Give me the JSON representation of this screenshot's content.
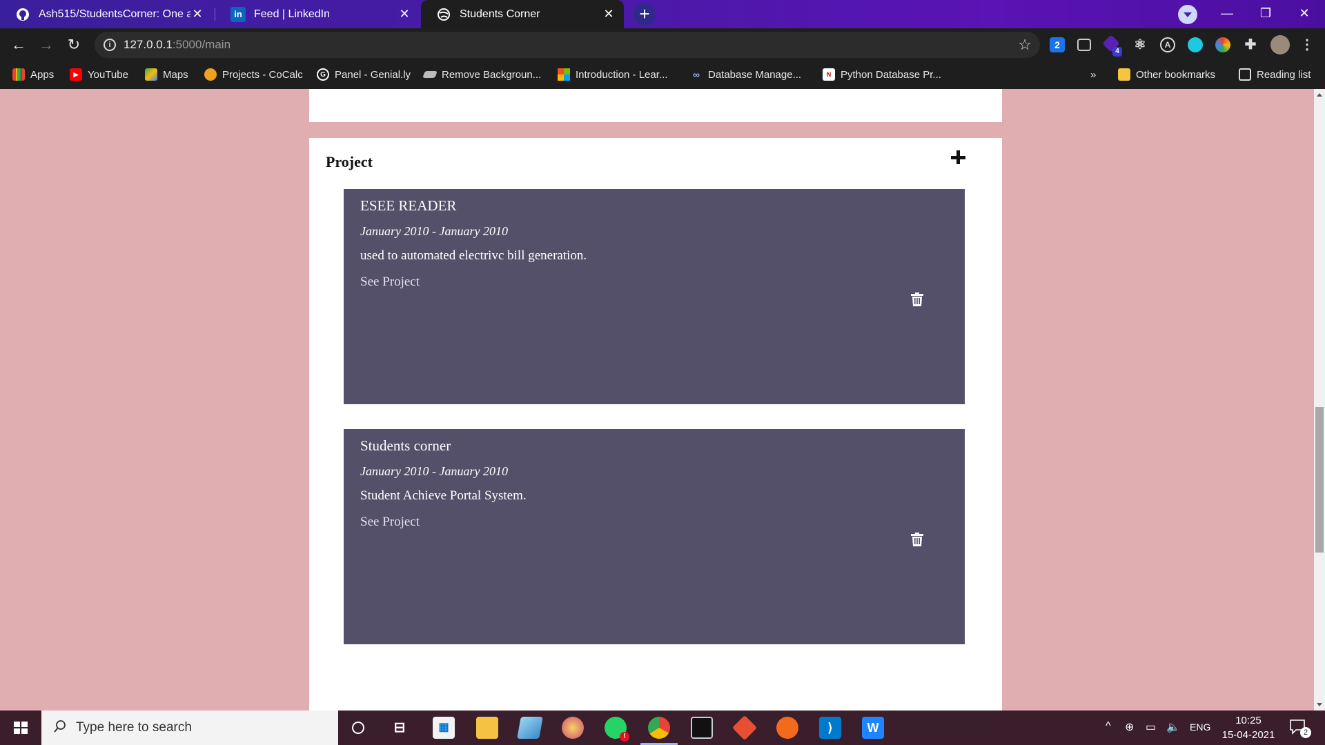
{
  "browser": {
    "tabs": [
      {
        "title": "Ash515/StudentsCorner: One app",
        "favicon": "github-icon",
        "active": false
      },
      {
        "title": "Feed | LinkedIn",
        "favicon": "linkedin-icon",
        "active": false
      },
      {
        "title": "Students Corner",
        "favicon": "globe-icon",
        "active": true
      }
    ],
    "url_host": "127.0.0.1",
    "url_path": ":5000/main",
    "extension_badges": {
      "ext1": "2",
      "ext2_badge": "4"
    },
    "bookmarks": [
      {
        "label": "Apps",
        "icon": "apps-grid-icon"
      },
      {
        "label": "YouTube",
        "icon": "youtube-icon"
      },
      {
        "label": "Maps",
        "icon": "maps-icon"
      },
      {
        "label": "Projects - CoCalc",
        "icon": "cocalc-icon"
      },
      {
        "label": "Panel - Genial.ly",
        "icon": "genially-icon"
      },
      {
        "label": "Remove Backgroun...",
        "icon": "removebg-icon"
      },
      {
        "label": "Introduction - Lear...",
        "icon": "microsoft-icon"
      },
      {
        "label": "Database Manage...",
        "icon": "link-icon"
      },
      {
        "label": "Python Database Pr...",
        "icon": "page-icon"
      }
    ],
    "overflow": "»",
    "other_bookmarks": "Other bookmarks",
    "reading_list": "Reading list"
  },
  "page": {
    "section_title": "Project",
    "projects": [
      {
        "name": "ESEE READER",
        "dates": "January 2010 - January 2010",
        "description": "used to automated electrivc bill generation.",
        "link_label": "See Project"
      },
      {
        "name": "Students corner",
        "dates": "January 2010 - January 2010",
        "description": "Student Achieve Portal System.",
        "link_label": "See Project"
      }
    ]
  },
  "taskbar": {
    "search_placeholder": "Type here to search",
    "language": "ENG",
    "time": "10:25",
    "date": "15-04-2021",
    "notification_count": "2"
  },
  "colors": {
    "page_background": "#e0adb1",
    "card_background": "#54506a",
    "tabstrip_accent": "#4a1aa8"
  }
}
